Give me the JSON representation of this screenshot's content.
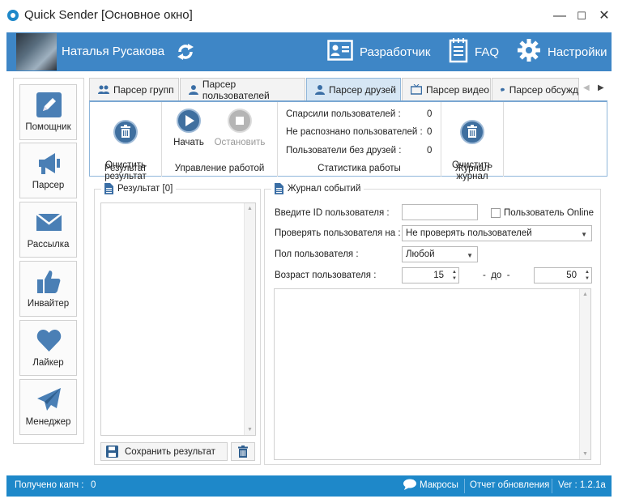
{
  "window": {
    "title": "Quick Sender [Основное окно]",
    "controls": [
      "—",
      "☐",
      "✕"
    ]
  },
  "header": {
    "user_name": "Наталья Русакова",
    "buttons": [
      {
        "label": "Разработчик",
        "icon": "id-card-icon"
      },
      {
        "label": "FAQ",
        "icon": "notepad-icon"
      },
      {
        "label": "Настройки",
        "icon": "gear-icon"
      }
    ]
  },
  "sidebar": {
    "items": [
      {
        "label": "Помощник",
        "icon": "pencil-icon"
      },
      {
        "label": "Парсер",
        "icon": "megaphone-icon"
      },
      {
        "label": "Рассылка",
        "icon": "envelope-icon"
      },
      {
        "label": "Инвайтер",
        "icon": "thumbs-up-icon"
      },
      {
        "label": "Лайкер",
        "icon": "heart-icon"
      },
      {
        "label": "Менеджер",
        "icon": "paper-plane-icon"
      }
    ]
  },
  "tabs": [
    {
      "label": "Парсер групп",
      "active": false
    },
    {
      "label": "Парсер пользователей",
      "active": false
    },
    {
      "label": "Парсер друзей",
      "active": true
    },
    {
      "label": "Парсер видео",
      "active": false
    },
    {
      "label": "Парсер обсужд",
      "active": false
    }
  ],
  "ribbon": {
    "result_group": {
      "title": "Результат",
      "clear_button": "Очистить\nрезультат"
    },
    "control_group": {
      "title": "Управление работой",
      "start_button": "Начать",
      "stop_button": "Остановить"
    },
    "stats_group": {
      "title": "Статистика работы",
      "rows": [
        {
          "label": "Спарсили пользователей :",
          "value": "0"
        },
        {
          "label": "Не распознано пользователей :",
          "value": "0"
        },
        {
          "label": "Пользователи без друзей :",
          "value": "0"
        }
      ]
    },
    "journal_group": {
      "title": "Журнал",
      "clear_button": "Очистить\nжурнал"
    }
  },
  "result_panel": {
    "title": "Результат [0]",
    "save_button": "Сохранить результат"
  },
  "log_panel": {
    "title": "Журнал событий",
    "user_id_label": "Введите ID пользователя :",
    "user_id_value": "",
    "online_checkbox_label": "Пользователь Online",
    "online_checked": false,
    "check_label": "Проверять пользователя на :",
    "check_value": "Не проверять пользователей",
    "gender_label": "Пол пользователя :",
    "gender_value": "Любой",
    "age_label": "Возраст пользователя :",
    "age_from": "15",
    "age_to_label": "-  до  -",
    "age_to": "50"
  },
  "statusbar": {
    "captcha_label": "Получено капч :",
    "captcha_value": "0",
    "macros": "Макросы",
    "update_report": "Отчет обновления",
    "version": "Ver : 1.2.1a"
  },
  "colors": {
    "accent": "#3e86c6",
    "statusbar": "#1e88c9",
    "icon_blue": "#4a7fb5"
  }
}
